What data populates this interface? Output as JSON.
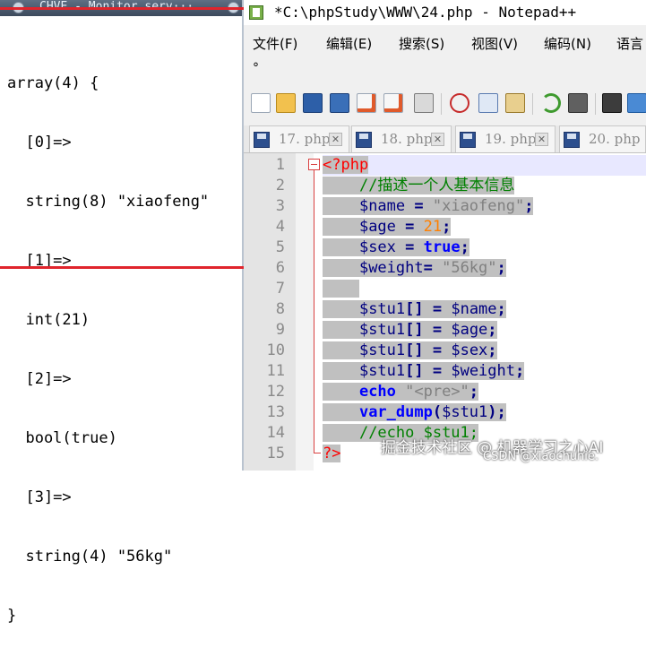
{
  "monitor": {
    "title": "CHVE - Monitor serv···",
    "dump_lines": [
      "array(4) {",
      "  [0]=>",
      "  string(8) \"xiaofeng\"",
      "  [1]=>",
      "  int(21)",
      "  [2]=>",
      "  bool(true)",
      "  [3]=>",
      "  string(4) \"56kg\"",
      "}"
    ]
  },
  "npp": {
    "title": "*C:\\phpStudy\\WWW\\24.php - Notepad++",
    "menu": [
      "文件(F)",
      "编辑(E)",
      "搜索(S)",
      "视图(V)",
      "编码(N)",
      "语言"
    ],
    "menu_overflow": "°",
    "toolbar_icons": [
      "new-file-icon",
      "open-file-icon",
      "save-icon",
      "save-all-icon",
      "close-icon",
      "close-all-icon",
      "print-icon",
      "cut-icon",
      "copy-icon",
      "paste-icon",
      "undo-icon",
      "redo-icon",
      "find-icon",
      "replace-icon"
    ],
    "tabs": [
      {
        "label": "17. php"
      },
      {
        "label": "18. php"
      },
      {
        "label": "19. php"
      },
      {
        "label": "20. php"
      }
    ],
    "tab_close": "✕",
    "line_numbers": [
      "1",
      "2",
      "3",
      "4",
      "5",
      "6",
      "7",
      "8",
      "9",
      "10",
      "11",
      "12",
      "13",
      "14",
      "15"
    ],
    "code": {
      "l1_tag": "<?php",
      "l2": "//描述一个人基本信息",
      "l3_var": "$name",
      "l3_op": " = ",
      "l3_val": "\"xiaofeng\"",
      "l3_end": ";",
      "l4_var": "$age",
      "l4_op": " = ",
      "l4_val": "21",
      "l4_end": ";",
      "l5_var": "$sex",
      "l5_op": " = ",
      "l5_val": "true",
      "l5_end": ";",
      "l6_var": "$weight",
      "l6_op": "= ",
      "l6_val": "\"56kg\"",
      "l6_end": ";",
      "l8_var": "$stu1",
      "l8_br": "[]",
      "l8_op": " = ",
      "l8_rhs": "$name",
      "l8_end": ";",
      "l9_var": "$stu1",
      "l9_br": "[]",
      "l9_op": " = ",
      "l9_rhs": "$age",
      "l9_end": ";",
      "l10_var": "$stu1",
      "l10_br": "[]",
      "l10_op": " = ",
      "l10_rhs": "$sex",
      "l10_end": ";",
      "l11_var": "$stu1",
      "l11_br": "[]",
      "l11_op": " = ",
      "l11_rhs": "$weight",
      "l11_end": ";",
      "l12_kw": "echo",
      "l12_str": " \"<pre>\"",
      "l12_end": ";",
      "l13_kw": "var_dump",
      "l13_open": "(",
      "l13_arg": "$stu1",
      "l13_close": ")",
      "l13_end": ";",
      "l14": "//echo $stu1;",
      "l15_tag": "?>"
    }
  },
  "watermark": {
    "line1": "掘金技术社区 @ 机器学习之心AI",
    "line2": "CSDN @xiaochunie."
  },
  "colors": {
    "highlight_box": "#e0242c",
    "selection": "#c0c0c0",
    "php_tag": "#ff0000",
    "comment": "#008000",
    "string": "#808080",
    "number": "#ff8000",
    "keyword": "#0000ff"
  }
}
